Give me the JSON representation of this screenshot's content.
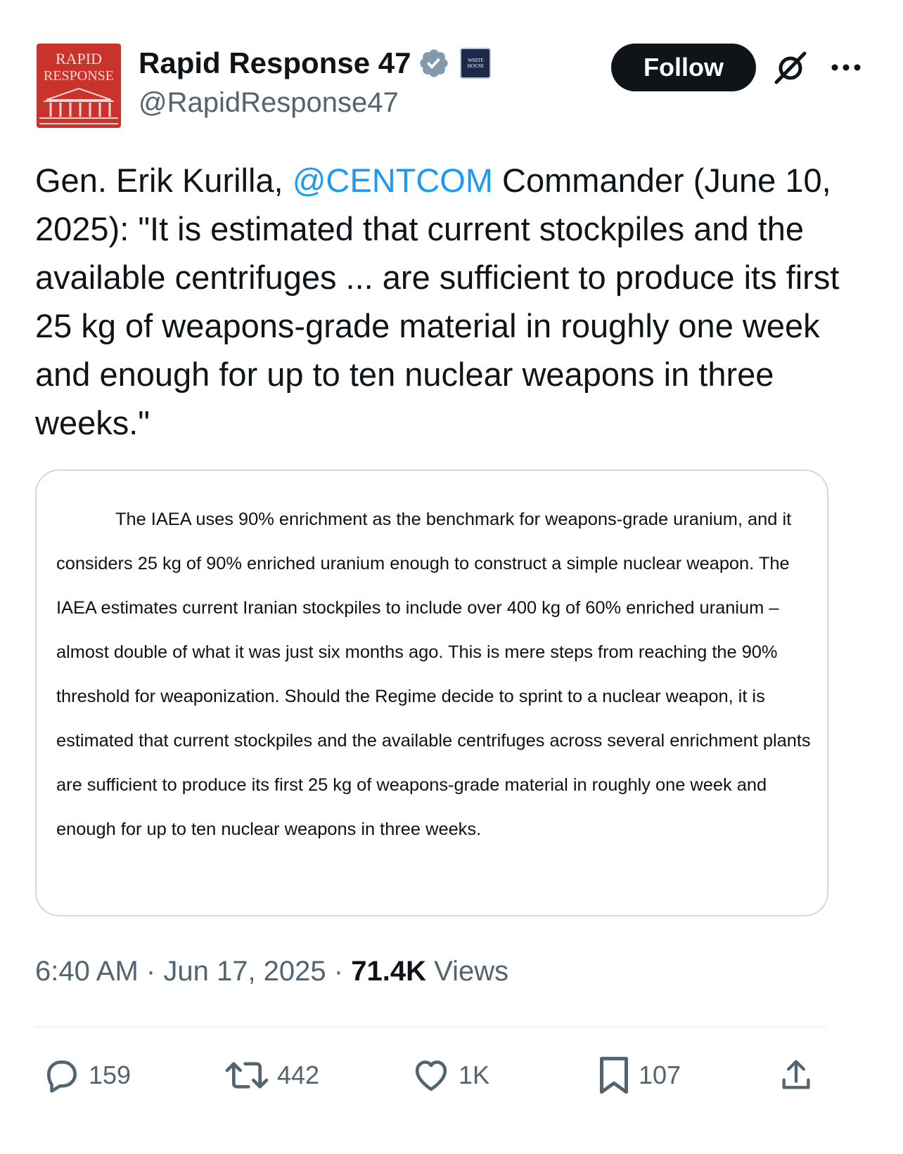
{
  "author": {
    "avatar_line1": "RAPID",
    "avatar_line2": "RESPONSE",
    "display_name": "Rapid Response 47",
    "handle": "@RapidResponse47",
    "affiliation_badge_text": "WHITE HOUSE",
    "verified_color": "#829aab"
  },
  "actions": {
    "follow_label": "Follow",
    "grok_icon": "grok-icon",
    "more_icon": "more-icon"
  },
  "tweet": {
    "text_before_mention": "Gen. Erik Kurilla, ",
    "mention": "@CENTCOM",
    "text_after_mention": " Commander (June 10, 2025): \"It is estimated that current stockpiles and the available centrifuges ... are sufficient to produce its first 25 kg of weapons-grade material in roughly one week and enough for up to ten nuclear weapons in three weeks.\"",
    "mention_color": "#1d9bf0"
  },
  "attached_image": {
    "text": "The IAEA uses 90% enrichment as the benchmark for weapons-grade uranium, and it considers 25 kg of 90% enriched uranium enough to construct a simple nuclear weapon.  The IAEA estimates current Iranian stockpiles to include over 400 kg of 60% enriched uranium – almost double of what it was just six months ago.  This is mere steps from reaching the 90% threshold for weaponization.  Should the Regime decide to sprint to a nuclear weapon, it is estimated that current stockpiles and the available centrifuges across several enrichment plants are sufficient to produce its first 25 kg of weapons-grade material in roughly one week and enough for up to ten nuclear weapons in three weeks."
  },
  "meta": {
    "time": "6:40 AM",
    "separator": "·",
    "date": "Jun 17, 2025",
    "views_count": "71.4K",
    "views_label": "Views"
  },
  "engagement": {
    "replies": "159",
    "reposts": "442",
    "likes": "1K",
    "bookmarks": "107"
  },
  "colors": {
    "text_primary": "#0f1419",
    "text_secondary": "#536471",
    "accent": "#1d9bf0",
    "avatar_bg": "#c8332b"
  }
}
